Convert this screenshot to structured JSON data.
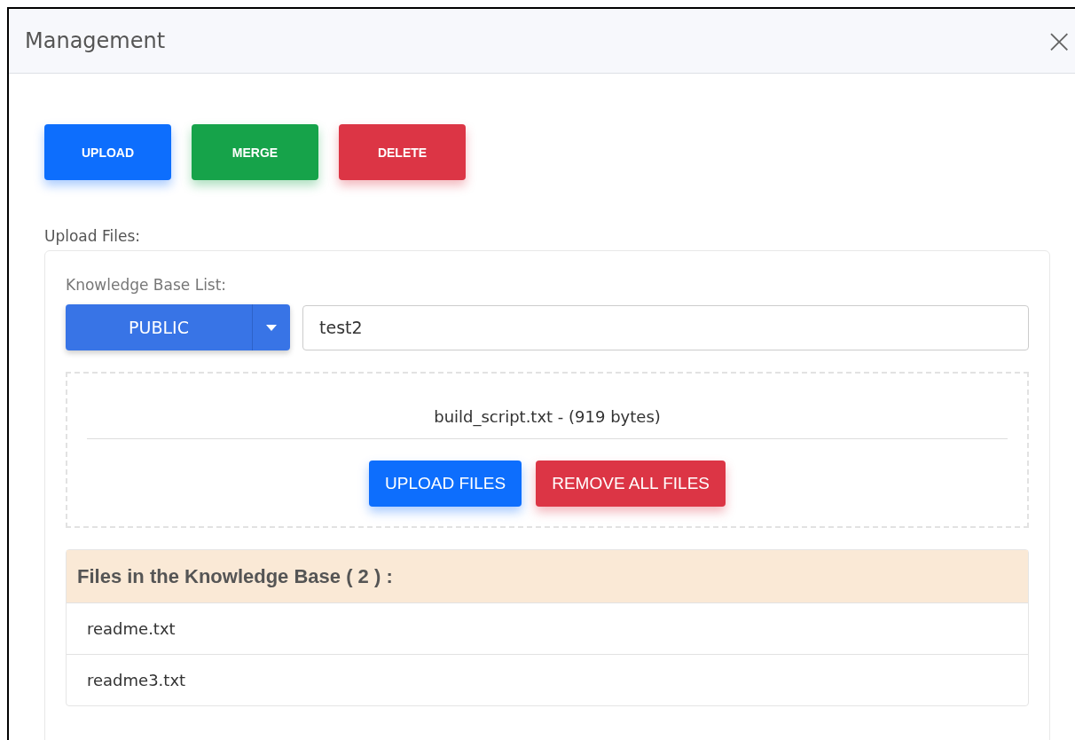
{
  "dialog": {
    "title": "Management",
    "close": "×"
  },
  "actions": [
    {
      "label": "UPLOAD",
      "kind": "primary"
    },
    {
      "label": "MERGE",
      "kind": "success"
    },
    {
      "label": "DELETE",
      "kind": "danger"
    }
  ],
  "upload_section": {
    "label": "Upload Files:",
    "kb_label": "Knowledge Base List:",
    "kb_select": "PUBLIC",
    "name_field": {
      "value": "test2"
    },
    "pending_files": [
      "build_script.txt - (919 bytes)"
    ],
    "buttons": [
      {
        "label": "UPLOAD FILES",
        "kind": "primary"
      },
      {
        "label": "REMOVE ALL FILES",
        "kind": "danger"
      }
    ]
  },
  "files_panel": {
    "heading": "Files in the Knowledge Base ( 2 ) :",
    "files": [
      "readme.txt",
      "readme3.txt"
    ]
  }
}
